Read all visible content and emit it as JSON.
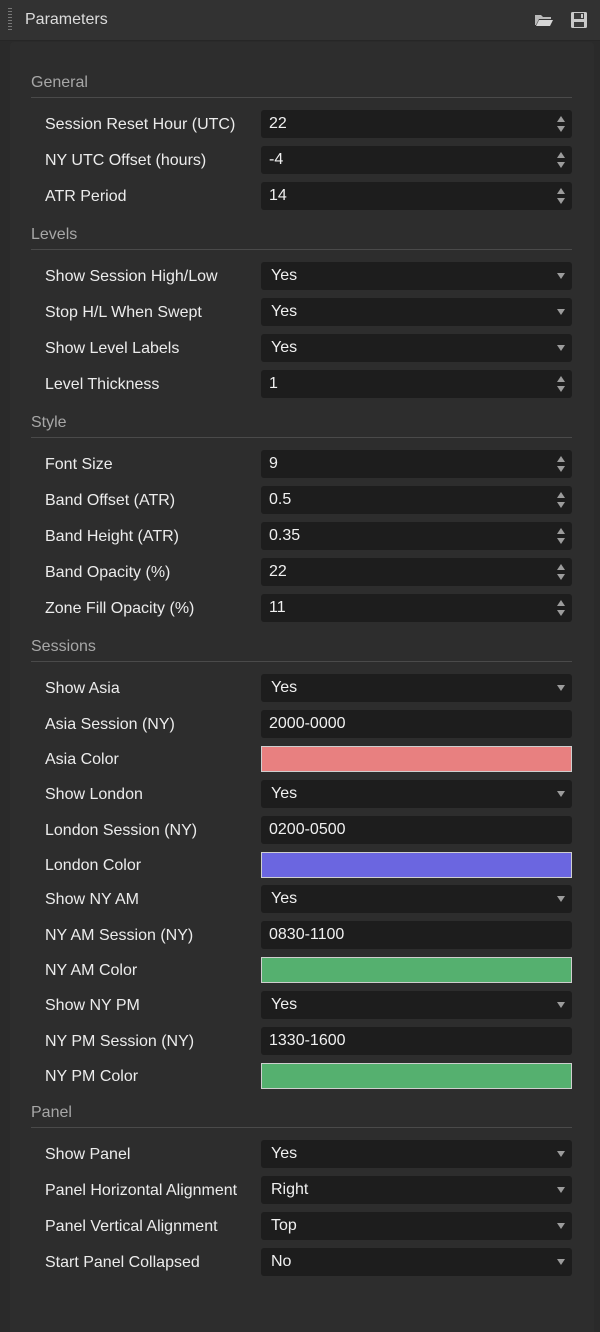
{
  "window": {
    "title": "Parameters"
  },
  "sections": {
    "general": "General",
    "levels": "Levels",
    "style": "Style",
    "sessions": "Sessions",
    "panel": "Panel"
  },
  "params": {
    "session_reset_hour": {
      "label": "Session Reset Hour (UTC)",
      "value": "22"
    },
    "ny_utc_offset": {
      "label": "NY UTC Offset (hours)",
      "value": "-4"
    },
    "atr_period": {
      "label": "ATR Period",
      "value": "14"
    },
    "show_session_hl": {
      "label": "Show Session High/Low",
      "value": "Yes"
    },
    "stop_hl_when_swept": {
      "label": "Stop H/L When Swept",
      "value": "Yes"
    },
    "show_level_labels": {
      "label": "Show Level Labels",
      "value": "Yes"
    },
    "level_thickness": {
      "label": "Level Thickness",
      "value": "1"
    },
    "font_size": {
      "label": "Font Size",
      "value": "9"
    },
    "band_offset": {
      "label": "Band Offset (ATR)",
      "value": "0.5"
    },
    "band_height": {
      "label": "Band Height (ATR)",
      "value": "0.35"
    },
    "band_opacity": {
      "label": "Band Opacity (%)",
      "value": "22"
    },
    "zone_fill_opacity": {
      "label": "Zone Fill Opacity (%)",
      "value": "11"
    },
    "show_asia": {
      "label": "Show Asia",
      "value": "Yes"
    },
    "asia_session": {
      "label": "Asia Session (NY)",
      "value": "2000-0000"
    },
    "asia_color": {
      "label": "Asia Color",
      "color": "#e88080"
    },
    "show_london": {
      "label": "Show London",
      "value": "Yes"
    },
    "london_session": {
      "label": "London Session (NY)",
      "value": "0200-0500"
    },
    "london_color": {
      "label": "London Color",
      "color": "#6b66e0"
    },
    "show_ny_am": {
      "label": "Show NY AM",
      "value": "Yes"
    },
    "ny_am_session": {
      "label": "NY AM Session (NY)",
      "value": "0830-1100"
    },
    "ny_am_color": {
      "label": "NY AM Color",
      "color": "#55b06f"
    },
    "show_ny_pm": {
      "label": "Show NY PM",
      "value": "Yes"
    },
    "ny_pm_session": {
      "label": "NY PM Session (NY)",
      "value": "1330-1600"
    },
    "ny_pm_color": {
      "label": "NY PM Color",
      "color": "#55b06f"
    },
    "show_panel": {
      "label": "Show Panel",
      "value": "Yes"
    },
    "panel_h_align": {
      "label": "Panel Horizontal Alignment",
      "value": "Right"
    },
    "panel_v_align": {
      "label": "Panel Vertical Alignment",
      "value": "Top"
    },
    "start_panel_collapsed": {
      "label": "Start Panel Collapsed",
      "value": "No"
    }
  }
}
